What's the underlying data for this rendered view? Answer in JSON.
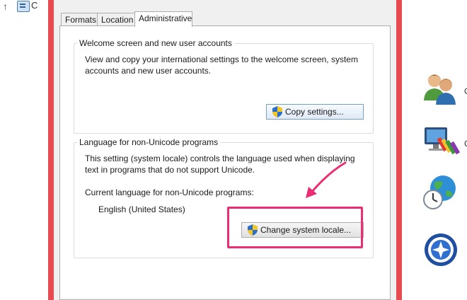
{
  "background": {
    "partial_letter": "C",
    "side_letters": [
      "C",
      "C"
    ]
  },
  "tabs": [
    {
      "label": "Formats"
    },
    {
      "label": "Location"
    },
    {
      "label": "Administrative"
    }
  ],
  "welcome_group": {
    "title": "Welcome screen and new user accounts",
    "text_line1": "View and copy your international settings to the welcome screen, system",
    "text_line2": "accounts and new user accounts.",
    "button_label": "Copy settings..."
  },
  "unicode_group": {
    "title": "Language for non-Unicode programs",
    "text_line1": "This setting (system locale) controls the language used when displaying",
    "text_line2": "text in programs that do not support Unicode.",
    "current_label": "Current language for non-Unicode programs:",
    "current_value": "English (United States)",
    "button_label": "Change system locale..."
  },
  "colors": {
    "window_frame": "#e84a51",
    "highlight": "#ec2d73",
    "arrow": "#ec2d73"
  },
  "icons": [
    "up-arrow-icon",
    "control-panel-icon",
    "user-accounts-icon",
    "display-icon",
    "globe-clock-icon",
    "ease-of-access-icon",
    "shield-icon"
  ]
}
